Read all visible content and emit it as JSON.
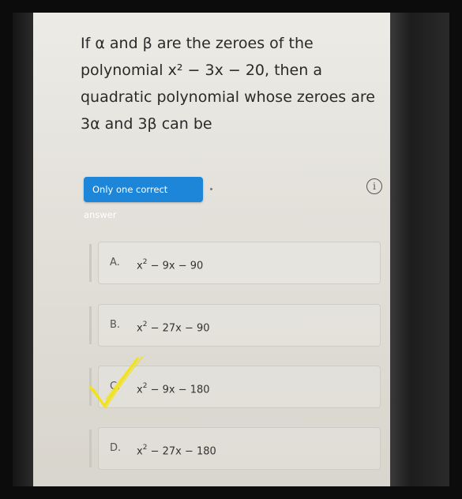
{
  "question": {
    "lines": [
      "If α and β are the zeroes of the",
      "polynomial x² − 3x − 20, then a",
      "quadratic polynomial whose zeroes are",
      "3α and 3β can be"
    ]
  },
  "badge": {
    "label": "Only one correct answer"
  },
  "info": {
    "label": "i"
  },
  "options": [
    {
      "letter": "A.",
      "base": "x",
      "sup": "2",
      "rest": " − 9x − 90"
    },
    {
      "letter": "B.",
      "base": "x",
      "sup": "2",
      "rest": " − 27x − 90"
    },
    {
      "letter": "C.",
      "base": "x",
      "sup": "2",
      "rest": " − 9x − 180"
    },
    {
      "letter": "D.",
      "base": "x",
      "sup": "2",
      "rest": " − 27x − 180"
    }
  ],
  "marked_option": "C",
  "colors": {
    "badge": "#1d86d8",
    "tick": "#f2e21a"
  }
}
